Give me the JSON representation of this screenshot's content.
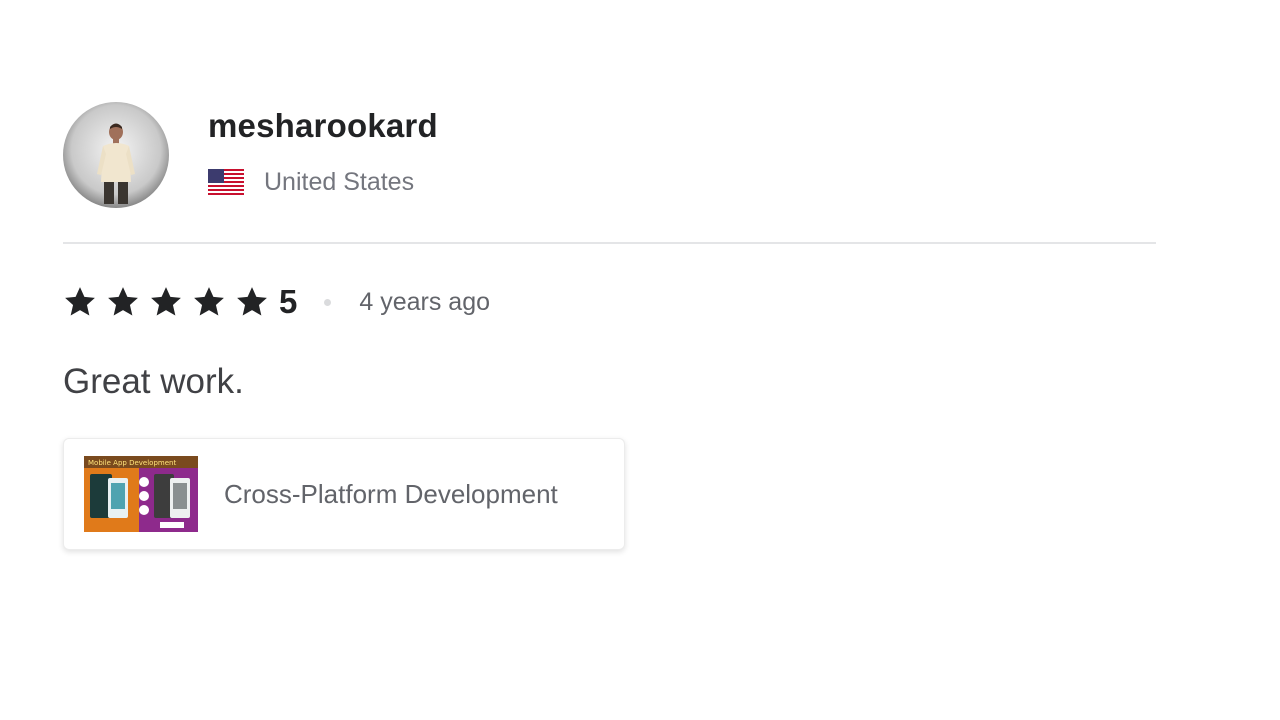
{
  "reviewer": {
    "username": "mesharookard",
    "country": "United States",
    "flag_icon": "us-flag-icon",
    "avatar_icon": "avatar-photo"
  },
  "rating": {
    "stars": 5,
    "max_stars": 5,
    "score_label": "5",
    "time_ago": "4 years ago",
    "star_color": "#222325"
  },
  "review": {
    "comment": "Great work."
  },
  "gig": {
    "title": "Cross-Platform Development",
    "thumbnail_icon": "gig-thumbnail"
  },
  "colors": {
    "text_primary": "#222325",
    "text_secondary": "#74767e",
    "divider": "#e4e5e7"
  }
}
